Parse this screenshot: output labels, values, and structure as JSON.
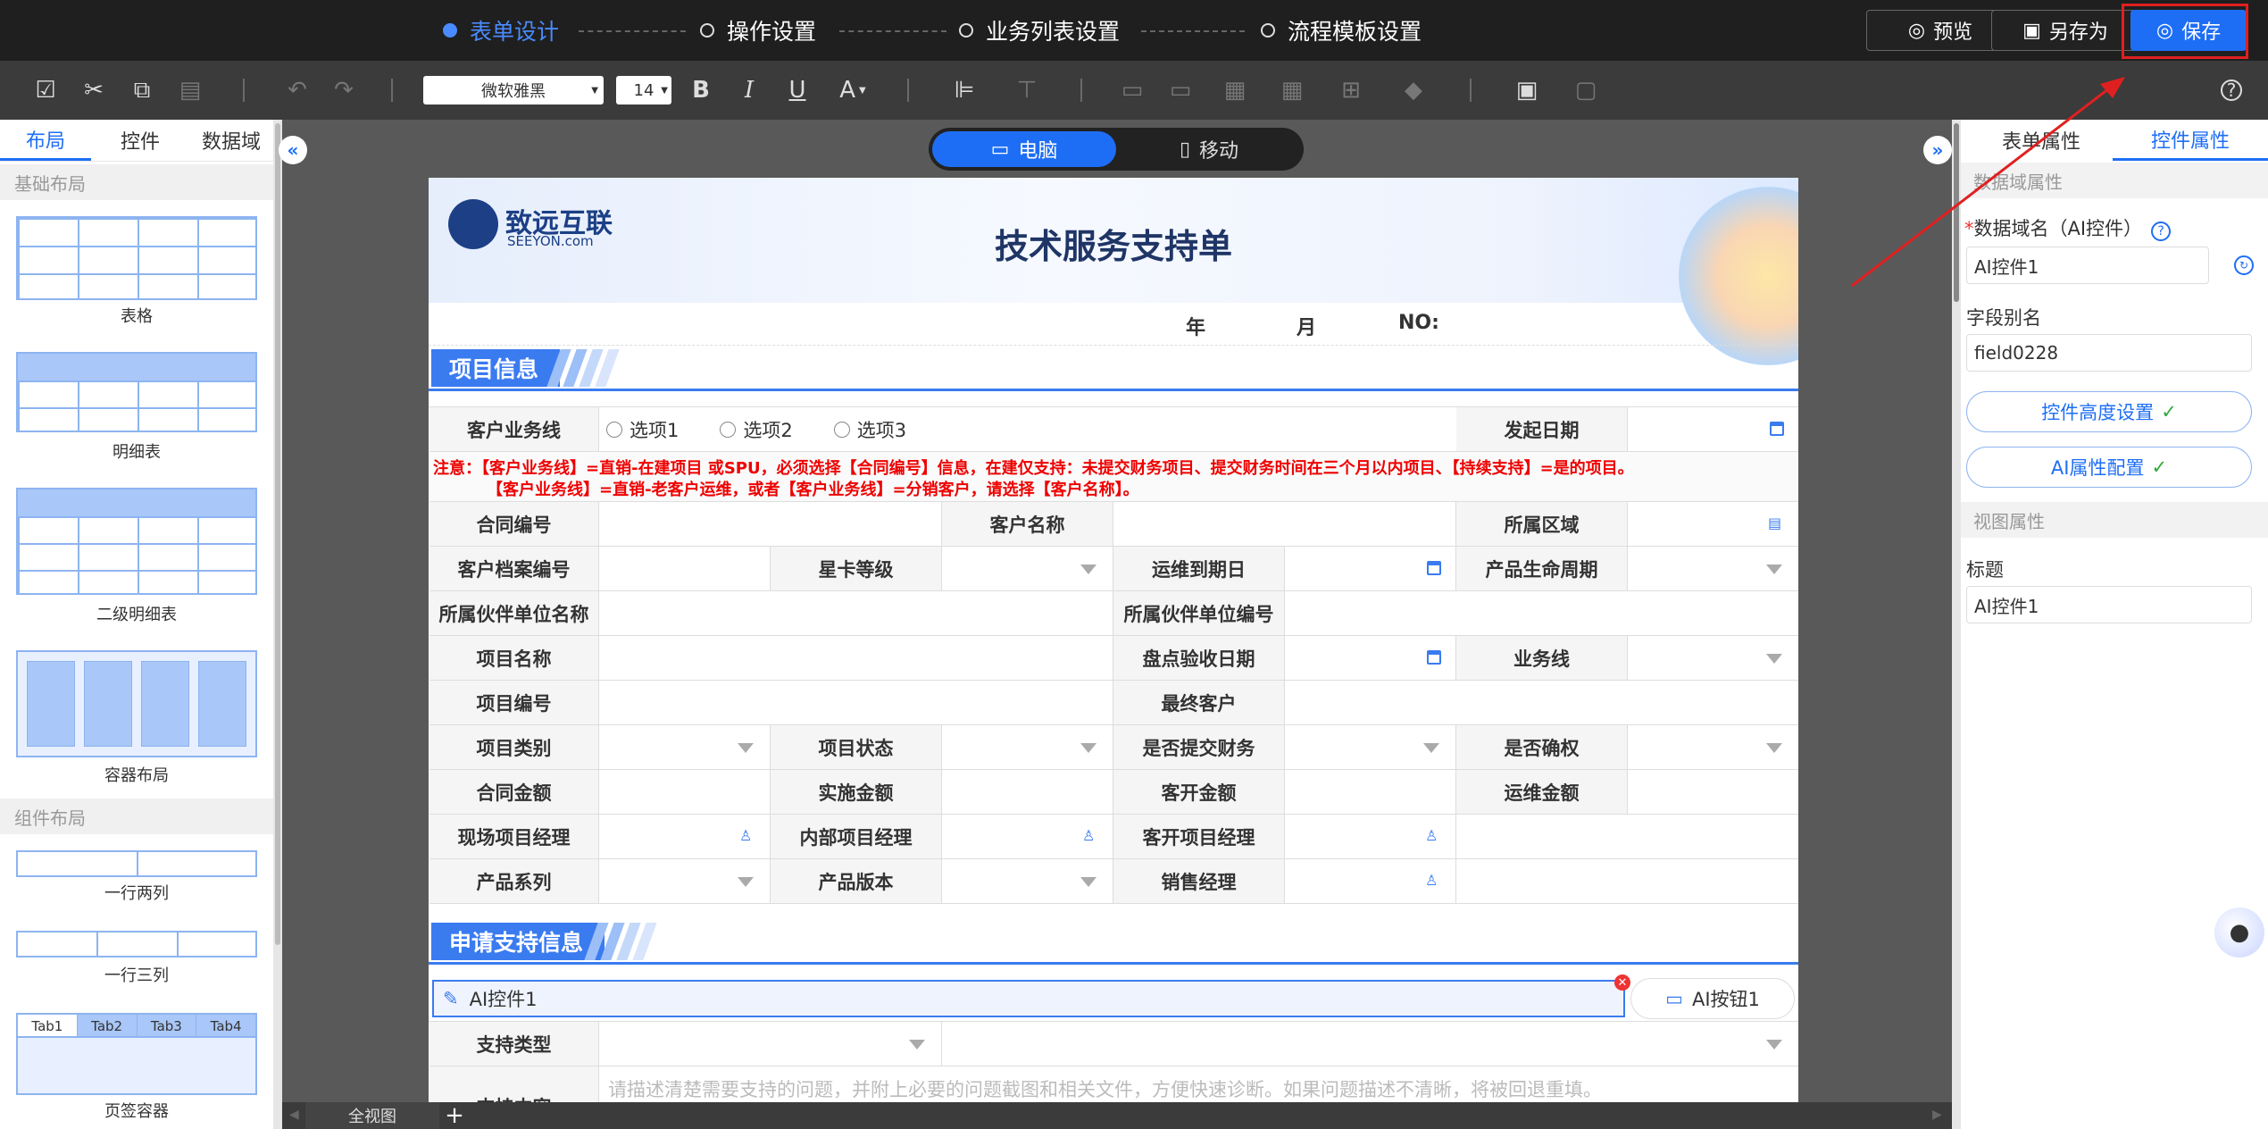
{
  "steps": [
    {
      "label": "表单设计"
    },
    {
      "label": "操作设置"
    },
    {
      "label": "业务列表设置"
    },
    {
      "label": "流程模板设置"
    }
  ],
  "top_buttons": {
    "preview": "预览",
    "save_as": "另存为",
    "save": "保存"
  },
  "toolbar": {
    "font": "微软雅黑",
    "font_size": "14",
    "bold": "B",
    "italic": "I",
    "underline": "U",
    "color": "A",
    "help": "?"
  },
  "left_panel": {
    "tabs": [
      "布局",
      "控件",
      "数据域"
    ],
    "section_basic": "基础布局",
    "section_component": "组件布局",
    "items": [
      "表格",
      "明细表",
      "二级明细表",
      "容器布局",
      "一行两列",
      "一行三列",
      "页签容器"
    ],
    "tab_container_tabs": [
      "Tab1",
      "Tab2",
      "Tab3",
      "Tab4"
    ]
  },
  "device": {
    "pc": "电脑",
    "mobile": "移动"
  },
  "form": {
    "logo_text": "致远互联",
    "logo_sub": "SEEYON.com",
    "title": "技术服务支持单",
    "date_row": {
      "year": "年",
      "month": "月",
      "no": "NO:"
    },
    "section1": "项目信息",
    "section2": "申请支持信息",
    "business_line_label": "客户业务线",
    "options": [
      "选项1",
      "选项2",
      "选项3"
    ],
    "start_date_label": "发起日期",
    "note1": "注意：【客户业务线】=直销-在建项目 或SPU，必须选择【合同编号】信息，在建仅支持：未提交财务项目、提交财务时间在三个月以内项目、【持续支持】=是的项目。",
    "note2": "【客户业务线】=直销-老客户运维，或者【客户业务线】=分销客户，请选择【客户名称】。",
    "labels": {
      "contract_no": "合同编号",
      "customer_name": "客户名称",
      "region": "所属区域",
      "archive_no": "客户档案编号",
      "star_level": "星卡等级",
      "maint_expiry": "运维到期日",
      "product_lifecycle": "产品生命周期",
      "partner_name": "所属伙伴单位名称",
      "partner_no": "所属伙伴单位编号",
      "project_name": "项目名称",
      "acceptance_date": "盘点验收日期",
      "business_line": "业务线",
      "project_no": "项目编号",
      "final_customer": "最终客户",
      "project_type": "项目类别",
      "project_status": "项目状态",
      "submitted_finance": "是否提交财务",
      "confirmed": "是否确权",
      "contract_amount": "合同金额",
      "impl_amount": "实施金额",
      "customer_amount": "客开金额",
      "maint_amount": "运维金额",
      "site_pm": "现场项目经理",
      "internal_pm": "内部项目经理",
      "custom_pm": "客开项目经理",
      "product_series": "产品系列",
      "product_version": "产品版本",
      "sales_manager": "销售经理",
      "support_type": "支持类型",
      "support_content": "支持内容"
    },
    "ai_control": "AI控件1",
    "ai_button": "AI按钮1",
    "support_placeholder": "请描述清楚需要支持的问题，并附上必要的问题截图和相关文件，方便快速诊断。如果问题描述不清晰，将被回退重填。"
  },
  "right_panel": {
    "tabs": [
      "表单属性",
      "控件属性"
    ],
    "section_data": "数据域属性",
    "field_name_label": "数据域名（AI控件）",
    "required_mark": "*",
    "field_name_value": "AI控件1",
    "alias_label": "字段别名",
    "alias_value": "field0228",
    "height_btn": "控件高度设置",
    "ai_config_btn": "AI属性配置",
    "section_view": "视图属性",
    "title_label": "标题",
    "title_value": "AI控件1"
  },
  "bottom": {
    "full_view": "全视图",
    "add": "+"
  },
  "colors": {
    "accent": "#1e6ef5",
    "highlight": "#e02020",
    "note": "#e00000"
  }
}
